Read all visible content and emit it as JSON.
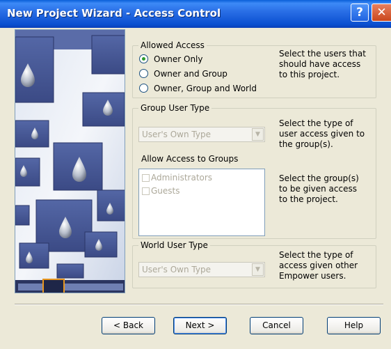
{
  "window": {
    "title": "New Project Wizard - Access Control",
    "help_label": "?",
    "close_label": "✕"
  },
  "allowed_access": {
    "legend": "Allowed Access",
    "options": [
      "Owner Only",
      "Owner and Group",
      "Owner, Group and World"
    ],
    "selected": "Owner Only",
    "description": [
      "Select the users that",
      "should have access",
      "to this project."
    ]
  },
  "group_user_type": {
    "legend": "Group User Type",
    "combo_value": "User's Own Type",
    "description": [
      "Select the type of",
      "user access given to",
      "the group(s)."
    ],
    "groups_label": "Allow Access to Groups",
    "groups": [
      {
        "label": "Administrators",
        "checked": false
      },
      {
        "label": "Guests",
        "checked": false
      }
    ],
    "groups_description": [
      "Select the group(s)",
      "to be given access",
      "to the project."
    ]
  },
  "world_user_type": {
    "legend": "World User Type",
    "combo_value": "User's Own Type",
    "description": [
      "Select the type of",
      "access given other",
      "Empower users."
    ]
  },
  "buttons": {
    "back": "< Back",
    "next": "Next >",
    "cancel": "Cancel",
    "help": "Help"
  }
}
